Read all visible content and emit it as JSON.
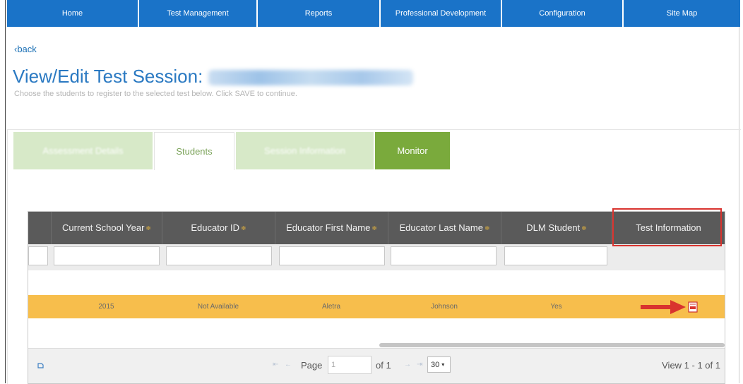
{
  "nav": [
    "Home",
    "Test Management",
    "Reports",
    "Professional Development",
    "Configuration",
    "Site Map"
  ],
  "back_label": "‹back",
  "title": "View/Edit Test Session:",
  "subtitle": "Choose the students to register to the selected test below. Click SAVE to continue.",
  "tabs": [
    "Assessment Details",
    "Students",
    "Session Information",
    "Monitor"
  ],
  "columns": [
    {
      "label": "Current School Year",
      "sortable": true
    },
    {
      "label": "Educator ID",
      "sortable": true
    },
    {
      "label": "Educator First Name",
      "sortable": true
    },
    {
      "label": "Educator Last Name",
      "sortable": true
    },
    {
      "label": "DLM Student",
      "sortable": true
    },
    {
      "label": "Test Information",
      "sortable": false
    }
  ],
  "sort_glyph": "≑",
  "row": [
    "2015",
    "Not Available",
    "Aletra",
    "Johnson",
    "Yes"
  ],
  "pager": {
    "page_label": "Page",
    "page_value": "1",
    "of_label": "of 1",
    "per_page": "30",
    "view_text": "View 1 - 1 of 1"
  },
  "colors": {
    "nav": "#1a73c8",
    "row_highlight": "#f7be4c",
    "header": "#5a5a5a",
    "monitor_tab": "#7aaa3c",
    "callout": "#d9332e"
  },
  "icons": [
    "refresh-icon",
    "first-page-icon",
    "prev-page-icon",
    "next-page-icon",
    "last-page-icon",
    "test-info-icon",
    "arrow-pointer-icon"
  ]
}
